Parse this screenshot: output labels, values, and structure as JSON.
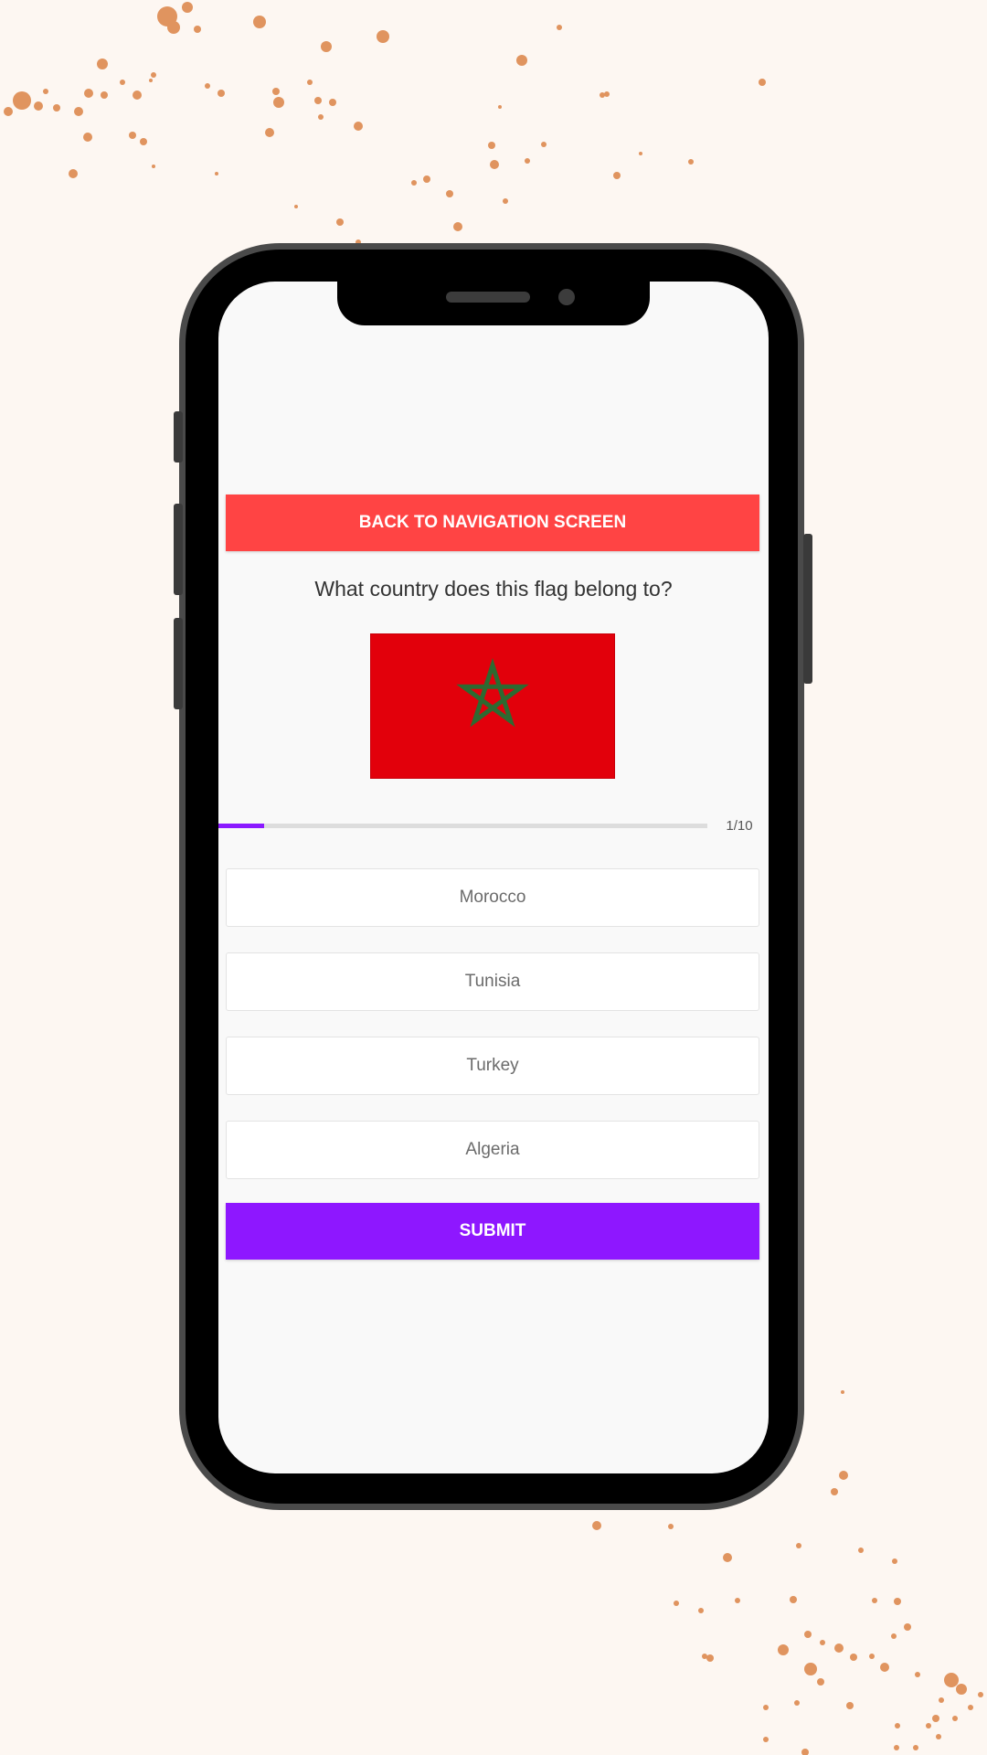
{
  "quiz": {
    "back_button_label": "BACK TO NAVIGATION SCREEN",
    "question": "What country does this flag belong to?",
    "flag": {
      "icon": "morocco-flag-icon",
      "field_color": "#e2000b",
      "star_color": "#2d6a31"
    },
    "progress": {
      "current": 1,
      "total": 10,
      "label": "1/10",
      "fraction": 0.1
    },
    "options": [
      {
        "label": "Morocco"
      },
      {
        "label": "Tunisia"
      },
      {
        "label": "Turkey"
      },
      {
        "label": "Algeria"
      }
    ],
    "submit_label": "SUBMIT"
  },
  "colors": {
    "back_button": "#ff4444",
    "submit_button": "#8e17ff",
    "progress_fill": "#8b19ff",
    "background": "#fdf7f2",
    "splatter": "#e0945f"
  }
}
